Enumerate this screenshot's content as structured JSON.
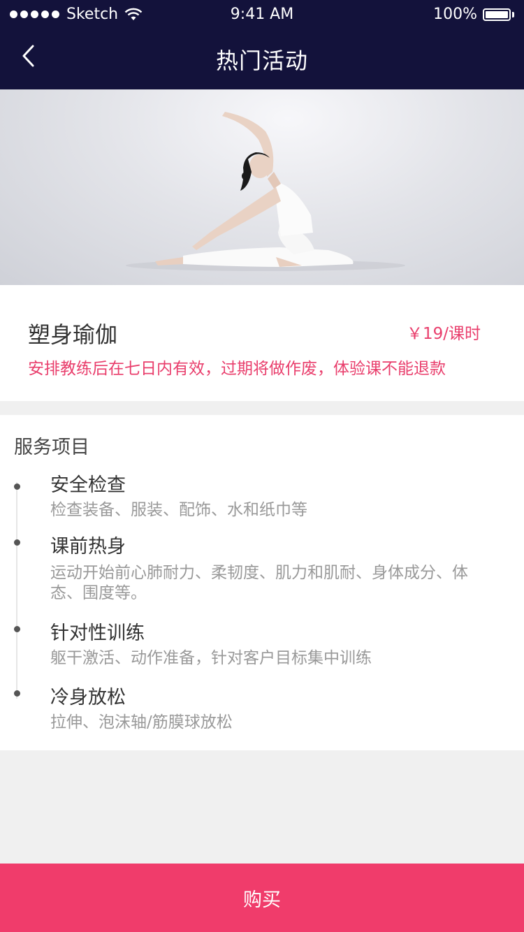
{
  "status_bar": {
    "carrier": "Sketch",
    "time": "9:41 AM",
    "battery": "100%"
  },
  "nav": {
    "title": "热门活动",
    "back_icon": "chevron-left-icon"
  },
  "course": {
    "name": "塑身瑜伽",
    "price": "￥19/课时",
    "notice": "安排教练后在七日内有效，过期将做作废，体验课不能退款"
  },
  "services": {
    "title": "服务项目",
    "items": [
      {
        "name": "安全检查",
        "desc": "检查装备、服装、配饰、水和纸巾等"
      },
      {
        "name": "课前热身",
        "desc": "运动开始前心肺耐力、柔韧度、肌力和肌耐、身体成分、体态、围度等。"
      },
      {
        "name": "针对性训练",
        "desc": "躯干激活、动作准备，针对客户目标集中训练"
      },
      {
        "name": "冷身放松",
        "desc": "拉伸、泡沫轴/筋膜球放松"
      }
    ]
  },
  "actions": {
    "buy_label": "购买"
  },
  "colors": {
    "nav_bg": "#13123b",
    "accent": "#f03c6b",
    "price_text": "#e93e6c"
  }
}
